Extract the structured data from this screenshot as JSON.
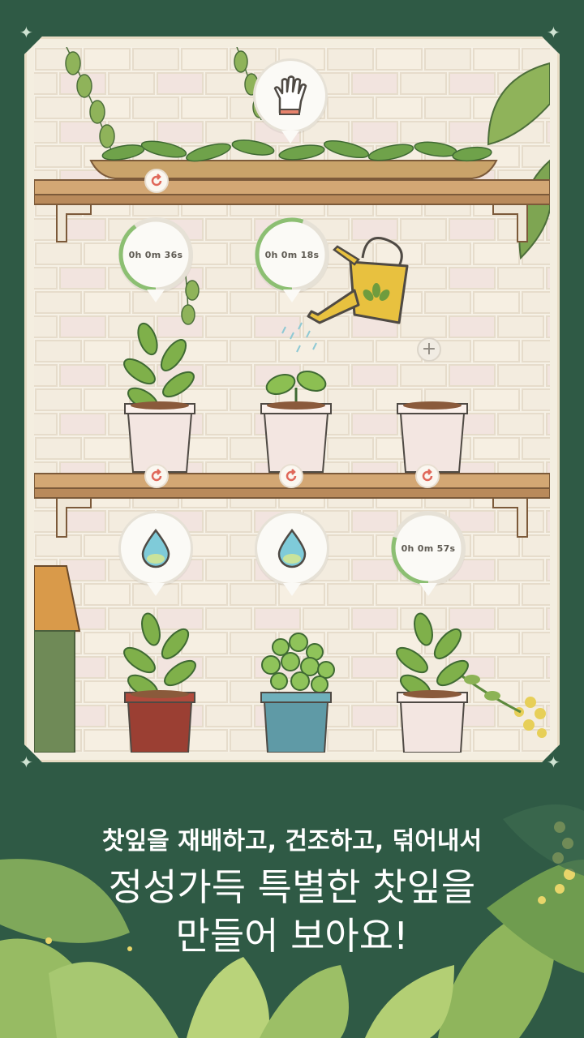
{
  "scene": {
    "tray": {
      "reset_icon": "refresh-icon",
      "bubble_icon": "glove-icon"
    },
    "shelf1": {
      "pots": [
        {
          "timer": "0h 0m 36s",
          "progress": 0.4,
          "plant": "grown-tea",
          "pot_color": "#f3e6e1"
        },
        {
          "timer": "0h 0m 18s",
          "progress": 0.55,
          "plant": "sprout",
          "pot_color": "#f3e6e1"
        },
        {
          "timer": "",
          "plant": "empty",
          "pot_color": "#f3e6e1"
        }
      ]
    },
    "shelf2": {
      "pots": [
        {
          "bubble_icon": "water-drop-icon",
          "plant": "grown-tea",
          "pot_color": "#9b3f33"
        },
        {
          "bubble_icon": "water-drop-icon",
          "plant": "mint",
          "pot_color": "#5f9aa6"
        },
        {
          "timer": "0h 0m 57s",
          "progress": 0.3,
          "plant": "grown-tea",
          "pot_color": "#f3e6e1"
        }
      ]
    },
    "watering_can_color": "#e8c13f"
  },
  "caption": {
    "line1": "찻잎을 재배하고, 건조하고, 덖어내서",
    "line2": "정성가득 특별한 찻잎을",
    "line3": "만들어 보아요!"
  },
  "colors": {
    "background": "#2f5a45",
    "frame": "#f4eee0",
    "shelf": "#c89a6a"
  }
}
